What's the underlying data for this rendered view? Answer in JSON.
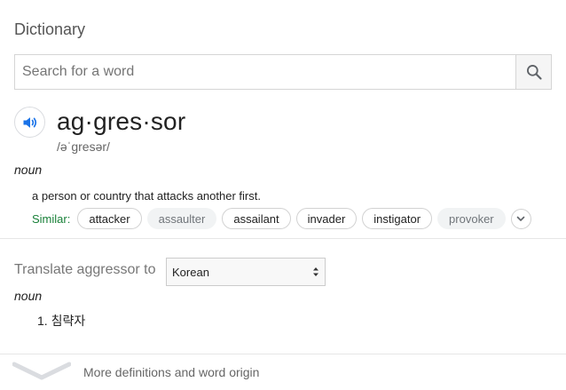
{
  "card": {
    "title": "Dictionary"
  },
  "search": {
    "placeholder": "Search for a word"
  },
  "entry": {
    "headword": "ag·gres·sor",
    "phonetic": "/əˈɡresər/",
    "part_of_speech": "noun",
    "definition": "a person or country that attacks another first.",
    "similar_label": "Similar:",
    "similar_words": [
      "attacker",
      "assaulter",
      "assailant",
      "invader",
      "instigator",
      "provoker"
    ]
  },
  "translate": {
    "label": "Translate aggressor to",
    "language": "Korean",
    "part_of_speech": "noun",
    "item_number": "1.",
    "item_text": "침략자"
  },
  "footer": {
    "more_label": "More definitions and word origin"
  },
  "icons": {
    "search": "search-icon",
    "speaker": "speaker-icon",
    "expand": "chevron-down-icon",
    "select_arrows": "select-arrows-icon",
    "more": "chevron-down-icon"
  },
  "colors": {
    "accent_blue": "#1a73e8",
    "similar_green": "#188038"
  }
}
